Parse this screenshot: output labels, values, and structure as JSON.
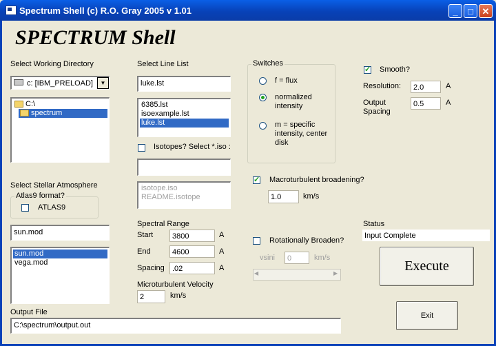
{
  "window": {
    "title": "Spectrum Shell (c) R.O. Gray 2005  v 1.01",
    "minimize": "_",
    "maximize": "□",
    "close": "✕"
  },
  "app_title": "SPECTRUM Shell",
  "working_dir": {
    "label": "Select Working Directory",
    "drive": "c: [IBM_PRELOAD]",
    "folders": [
      {
        "name": "C:\\",
        "selected": false
      },
      {
        "name": "spectrum",
        "selected": true
      }
    ]
  },
  "atmosphere": {
    "label": "Select Stellar Atmosphere",
    "group_title": "Atlas9 format?",
    "atlas9_label": "ATLAS9",
    "atlas9_checked": false,
    "file_value": "sun.mod",
    "files": [
      {
        "name": "sun.mod",
        "selected": true
      },
      {
        "name": "vega.mod",
        "selected": false
      }
    ]
  },
  "output": {
    "label": "Output File",
    "value": "C:\\spectrum\\output.out"
  },
  "line_list": {
    "label": "Select Line List",
    "value": "luke.lst",
    "files": [
      {
        "name": "6385.lst",
        "selected": false
      },
      {
        "name": "isoexample.lst",
        "selected": false
      },
      {
        "name": "luke.lst",
        "selected": true
      }
    ],
    "isotopes_label": "Isotopes?  Select *.iso :",
    "isotopes_checked": false,
    "iso_value": "",
    "iso_files": [
      "isotope.iso",
      "README.isotope"
    ]
  },
  "spectral_range": {
    "label": "Spectral Range",
    "start_label": "Start",
    "start": "3800",
    "end_label": "End",
    "end": "4600",
    "spacing_label": "Spacing",
    "spacing": ".02",
    "unit": "A"
  },
  "microturb": {
    "label": "Microturbulent Velocity",
    "value": "2",
    "unit": "km/s"
  },
  "switches": {
    "title": "Switches",
    "options": [
      {
        "label": "f = flux",
        "selected": false
      },
      {
        "label": "normalized intensity",
        "selected": true
      },
      {
        "label": "m = specific intensity, center disk",
        "selected": false
      }
    ]
  },
  "macroturb": {
    "label": "Macroturbulent broadening?",
    "checked": true,
    "value": "1.0",
    "unit": "km/s"
  },
  "rotation": {
    "label": "Rotationally Broaden?",
    "checked": false,
    "vsini_label": "vsini",
    "vsini": "0",
    "unit": "km/s"
  },
  "smooth": {
    "label": "Smooth?",
    "checked": true,
    "resolution_label": "Resolution:",
    "resolution": "2.0",
    "output_spacing_label": "Output Spacing",
    "output_spacing": "0.5",
    "unit": "A"
  },
  "status": {
    "label": "Status",
    "value": "Input Complete"
  },
  "buttons": {
    "execute": "Execute",
    "exit": "Exit"
  },
  "colors": {
    "titlebar": "#0842b8",
    "selection": "#316ac5",
    "background": "#ece9d8"
  }
}
